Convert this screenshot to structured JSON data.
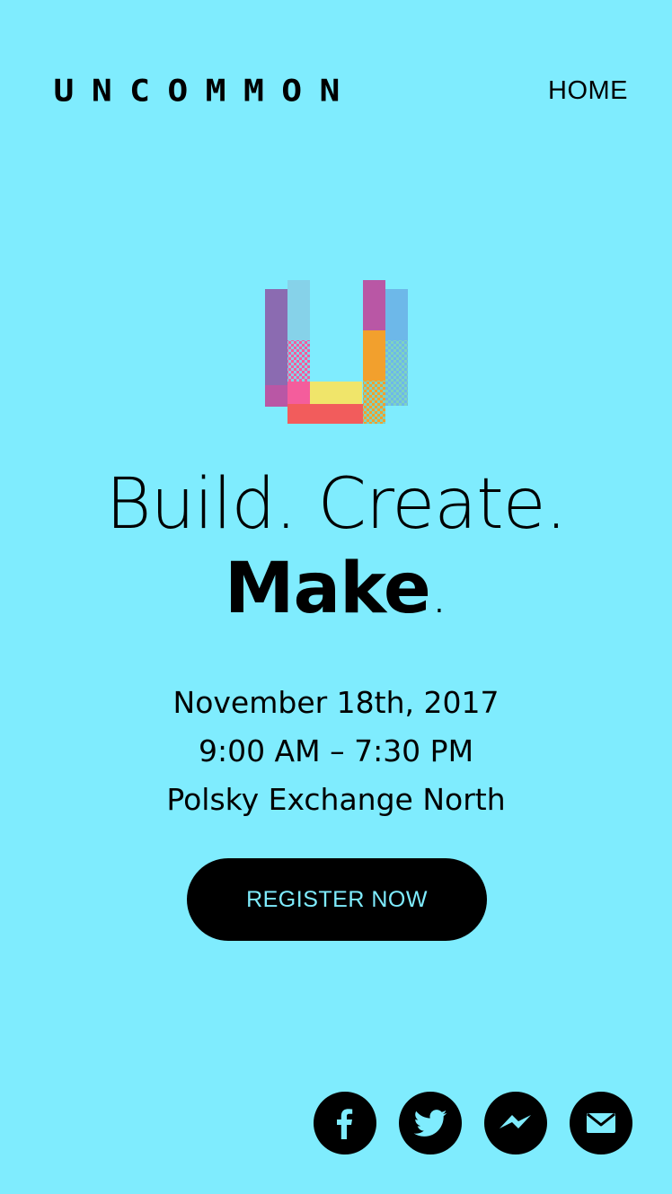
{
  "header": {
    "brand_letters": [
      "U",
      "N",
      "C",
      "O",
      "M",
      "M",
      "O",
      "N"
    ],
    "nav_home": "HOME"
  },
  "hero": {
    "headline_line1": "Build. Create.",
    "headline_line2": "Make",
    "headline_line2_period": "."
  },
  "event": {
    "date": "November 18th, 2017",
    "time": "9:00 AM – 7:30 PM",
    "venue": "Polsky Exchange North"
  },
  "cta": {
    "register_label": "REGISTER NOW"
  },
  "social": {
    "items": [
      {
        "name": "facebook",
        "icon": "facebook-icon"
      },
      {
        "name": "twitter",
        "icon": "twitter-icon"
      },
      {
        "name": "messenger",
        "icon": "messenger-icon"
      },
      {
        "name": "email",
        "icon": "email-icon"
      }
    ]
  },
  "colors": {
    "background": "#7fecfe",
    "text": "#000000",
    "button_bg": "#000000",
    "button_text": "#7fecfe",
    "logo_purple": "#8b6bb1",
    "logo_light_blue": "#86d2e9",
    "logo_magenta": "#b957a5",
    "logo_sky_blue": "#6db8e9",
    "logo_pink": "#f45d9c",
    "logo_red": "#f25c5c",
    "logo_yellow": "#f0e56a",
    "logo_orange": "#f2a02d",
    "logo_mint": "#7ed3c0"
  }
}
